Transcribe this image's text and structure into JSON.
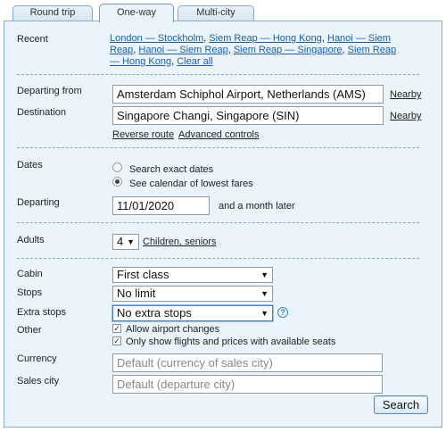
{
  "tabs": [
    "Round trip",
    "One-way",
    "Multi-city"
  ],
  "recent": {
    "label": "Recent",
    "links": [
      "London — Stockholm",
      "Siem Reap — Hong Kong",
      "Hanoi — Siem Reap",
      "Hanoi — Siem Reap",
      "Siem Reap — Singapore",
      "Siem Reap — Hong Kong",
      "Clear all"
    ]
  },
  "route": {
    "departing_from_label": "Departing from",
    "departing_from_value": "Amsterdam Schiphol Airport, Netherlands (AMS)",
    "destination_label": "Destination",
    "destination_value": "Singapore Changi, Singapore (SIN)",
    "nearby": "Nearby",
    "reverse": "Reverse route",
    "advanced": "Advanced controls"
  },
  "dates": {
    "label": "Dates",
    "option_exact": "Search exact dates",
    "option_calendar": "See calendar of lowest fares",
    "selected": "option_calendar",
    "departing_label": "Departing",
    "departing_value": "11/01/2020",
    "range_text": "and a month later"
  },
  "adults": {
    "label": "Adults",
    "value": "4",
    "children_link": "Children, seniors"
  },
  "options": {
    "cabin_label": "Cabin",
    "cabin_value": "First class",
    "stops_label": "Stops",
    "stops_value": "No limit",
    "extra_stops_label": "Extra stops",
    "extra_stops_value": "No extra stops",
    "other_label": "Other",
    "allow_airport_changes": "Allow airport changes",
    "only_available": "Only show flights and prices with available seats",
    "currency_label": "Currency",
    "currency_placeholder": "Default (currency of sales city)",
    "sales_city_label": "Sales city",
    "sales_city_placeholder": "Default (departure city)",
    "search_button": "Search"
  },
  "colors": {
    "panel": "#eaf4fa",
    "border": "#88adc7",
    "link": "#1a5fa5"
  }
}
